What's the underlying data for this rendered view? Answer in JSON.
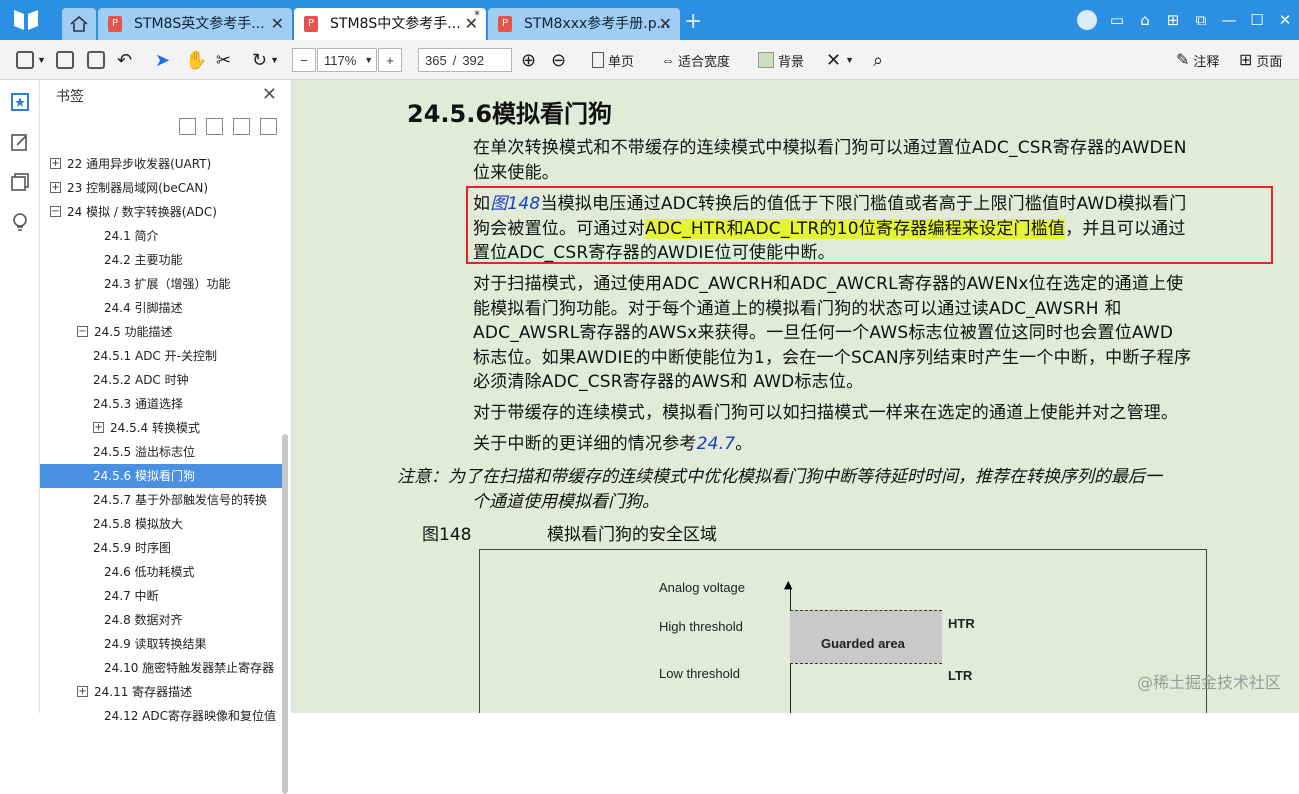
{
  "tabs": [
    {
      "label": "STM8S英文参考手..."
    },
    {
      "label": "STM8S中文参考手...",
      "active": true
    },
    {
      "label": "STM8xxx参考手册.p..."
    }
  ],
  "toolbar": {
    "zoom": "117%",
    "page_current": "365",
    "page_sep": "/",
    "page_total": "392",
    "single_page": "单页",
    "fit_width": "适合宽度",
    "background": "背景",
    "annotate": "注释",
    "pages": "页面"
  },
  "bookmarks": {
    "title": "书签",
    "items": [
      {
        "label": "22 通用异步收发器(UART)",
        "toggle": "+",
        "indent": 0
      },
      {
        "label": "23 控制器局域网(beCAN)",
        "toggle": "+",
        "indent": 0
      },
      {
        "label": "24 模拟 / 数字转换器(ADC)",
        "toggle": "−",
        "indent": 0
      },
      {
        "label": "24.1 简介",
        "toggle": "",
        "indent": 1
      },
      {
        "label": "24.2 主要功能",
        "toggle": "",
        "indent": 1
      },
      {
        "label": "24.3 扩展（增强）功能",
        "toggle": "",
        "indent": 1
      },
      {
        "label": "24.4 引脚描述",
        "toggle": "",
        "indent": 1
      },
      {
        "label": "24.5 功能描述",
        "toggle": "−",
        "indent": 1
      },
      {
        "label": "24.5.1 ADC 开-关控制",
        "toggle": "",
        "indent": 2
      },
      {
        "label": "24.5.2 ADC 时钟",
        "toggle": "",
        "indent": 2
      },
      {
        "label": "24.5.3 通道选择",
        "toggle": "",
        "indent": 2
      },
      {
        "label": "24.5.4 转换模式",
        "toggle": "+",
        "indent": 2
      },
      {
        "label": "24.5.5 溢出标志位",
        "toggle": "",
        "indent": 2
      },
      {
        "label": "24.5.6 模拟看门狗",
        "toggle": "",
        "indent": 2,
        "selected": true
      },
      {
        "label": "24.5.7 基于外部触发信号的转换",
        "toggle": "",
        "indent": 2
      },
      {
        "label": "24.5.8 模拟放大",
        "toggle": "",
        "indent": 2
      },
      {
        "label": "24.5.9 时序图",
        "toggle": "",
        "indent": 2
      },
      {
        "label": "24.6 低功耗模式",
        "toggle": "",
        "indent": 1
      },
      {
        "label": "24.7 中断",
        "toggle": "",
        "indent": 1
      },
      {
        "label": "24.8 数据对齐",
        "toggle": "",
        "indent": 1
      },
      {
        "label": "24.9 读取转换结果",
        "toggle": "",
        "indent": 1
      },
      {
        "label": "24.10   施密特触发器禁止寄存器",
        "toggle": "",
        "indent": 1
      },
      {
        "label": "24.11 寄存器描述",
        "toggle": "+",
        "indent": 1
      },
      {
        "label": "24.12 ADC寄存器映像和复位值",
        "toggle": "",
        "indent": 1
      }
    ]
  },
  "doc": {
    "heading": "24.5.6模拟看门狗",
    "para1a": "在单次转换模式和不带缓存的连续模式中模拟看门狗可以通过置位ADC_CSR寄存器的AWDEN",
    "para1b": "位来使能。",
    "para2_prefix": "如",
    "para2_link": "图148",
    "para2_a": "当模拟电压通过ADC转换后的值低于下限门槛值或者高于上限门槛值时AWD模拟看门",
    "para2_b": "狗会被置位。可通过对",
    "para2_hl": "ADC_HTR和ADC_LTR的10位寄存器编程来设定门槛值",
    "para2_c": "，并且可以通过",
    "para2_d": "置位ADC_CSR寄存器的AWDIE位可使能中断。",
    "para3a": "对于扫描模式，通过使用ADC_AWCRH和ADC_AWCRL寄存器的AWENx位在选定的通道上使",
    "para3b": "能模拟看门狗功能。对于每个通道上的模拟看门狗的状态可以通过读ADC_AWSRH 和",
    "para3c": "ADC_AWSRL寄存器的AWSx来获得。一旦任何一个AWS标志位被置位这同时也会置位AWD",
    "para3d": "标志位。如果AWDIE的中断使能位为1，会在一个SCAN序列结束时产生一个中断，中断子程序",
    "para3e": "必须清除ADC_CSR寄存器的AWS和 AWD标志位。",
    "para4": "对于带缓存的连续模式，模拟看门狗可以如扫描模式一样来在选定的通道上使能并对之管理。",
    "para5_prefix": "关于中断的更详细的情况参考",
    "para5_link": "24.7",
    "para5_suffix": "。",
    "note_a": "注意：为了在扫描和带缓存的连续模式中优化模拟看门狗中断等待延时时间，推荐在转换序列的最后一",
    "note_b": "个通道使用模拟看门狗。",
    "fig_num": "图148",
    "fig_title": "模拟看门狗的安全区域",
    "fig_analog": "Analog voltage",
    "fig_high": "High threshold",
    "fig_low": "Low threshold",
    "fig_guarded": "Guarded area",
    "fig_htr": "HTR",
    "fig_ltr": "LTR"
  },
  "watermark": "@稀土掘金技术社区",
  "colors": {
    "titlebar": "#2b8fe3",
    "page_bg": "#e1ebd7",
    "highlight": "#e6f432",
    "annotation_box": "#e0252b",
    "selection": "#4a90e2"
  }
}
